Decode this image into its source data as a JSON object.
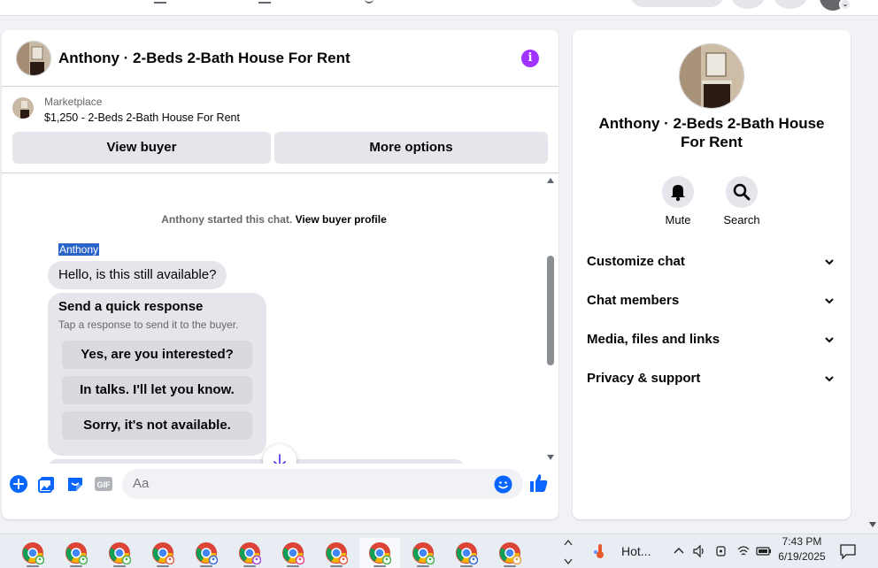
{
  "chat": {
    "title": "Anthony · 2-Beds 2-Bath House For Rent",
    "listing_source": "Marketplace",
    "listing_price_title": "$1,250 - 2-Beds 2-Bath House For Rent",
    "view_buyer_label": "View buyer",
    "more_options_label": "More options",
    "system_note_prefix": "Anthony started this chat.",
    "system_note_link": "View buyer profile",
    "sender_name": "Anthony",
    "first_message": "Hello, is this still available?",
    "quick_response": {
      "title": "Send a quick response",
      "subtitle": "Tap a response to send it to the buyer.",
      "options": [
        "Yes, are you interested?",
        "In talks. I'll let you know.",
        "Sorry, it's not available."
      ]
    },
    "composer_placeholder": "Aa"
  },
  "info_panel": {
    "title": "Anthony · 2-Beds 2-Bath House For Rent",
    "actions": [
      {
        "label": "Mute",
        "icon": "bell-icon"
      },
      {
        "label": "Search",
        "icon": "search-icon"
      }
    ],
    "sections": [
      "Customize chat",
      "Chat members",
      "Media, files and links",
      "Privacy & support"
    ]
  },
  "taskbar": {
    "weather_text": "Hot...",
    "time": "7:43 PM",
    "date": "6/19/2025"
  },
  "colors": {
    "accent_blue": "#0866ff",
    "info_purple": "#a033ff",
    "bubble_gray": "#e4e6eb"
  }
}
